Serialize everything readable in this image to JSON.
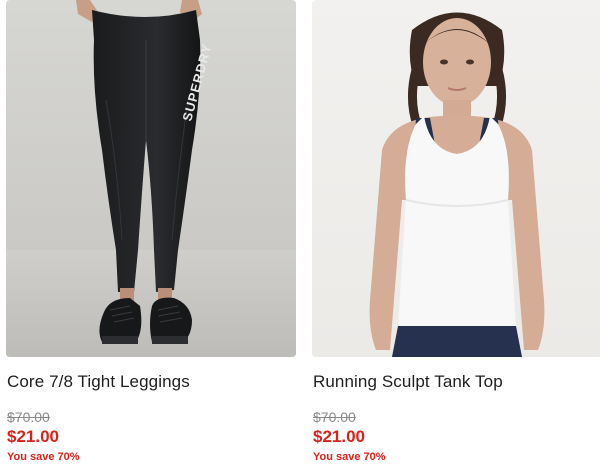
{
  "products": [
    {
      "name": "Core 7/8 Tight Leggings",
      "original_price": "$70.00",
      "sale_price": "$21.00",
      "savings": "You save 70%",
      "image_icon": "leggings-product-photo",
      "brand_print": "SUPERDRY"
    },
    {
      "name": "Running Sculpt Tank Top",
      "original_price": "$70.00",
      "sale_price": "$21.00",
      "savings": "You save 70%",
      "image_icon": "tank-top-product-photo"
    }
  ],
  "colors": {
    "sale_red": "#d6231c",
    "was_gray": "#8a8a8a",
    "title_text": "#1f1f1f"
  }
}
